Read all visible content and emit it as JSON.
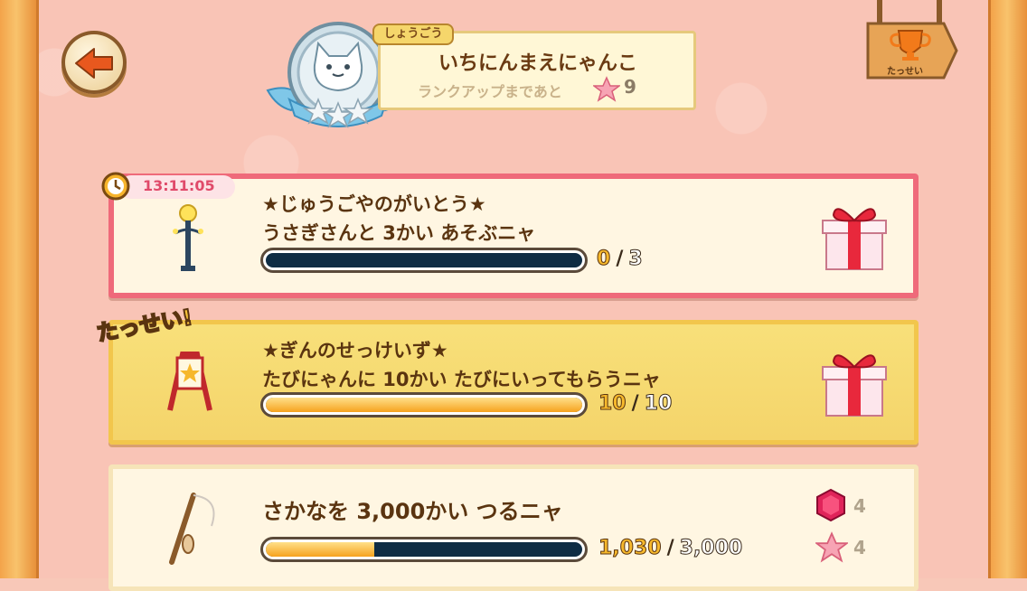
{
  "header": {
    "rank_tag": "しょうごう",
    "rank_title": "いちにんまえにゃんこ",
    "rank_up_text": "ランクアップまであと",
    "rank_up_count": "9",
    "achievements_label": "たっせい"
  },
  "missions": [
    {
      "timer": "13:11:05",
      "title_line1": "★じゅうごやのがいとう★",
      "title_line2": "うさぎさんと 3かい あそぶニャ",
      "current": "0",
      "total": "3",
      "progress_fraction": 0,
      "reward": "gift-box"
    },
    {
      "badge": "たっせい!",
      "title_line1": "★ぎんのせっけいず★",
      "title_line2": "たびにゃんに 10かい たびにいってもらうニャ",
      "current": "10",
      "total": "10",
      "progress_fraction": 1,
      "reward": "gift-box"
    },
    {
      "title_line1": "さかなを 3,000かい つるニャ",
      "current": "1,030",
      "total": "3,000",
      "progress_fraction": 0.343,
      "rewards": [
        {
          "icon": "gem-icon",
          "count": "4"
        },
        {
          "icon": "star-icon",
          "count": "4"
        }
      ]
    }
  ],
  "colors": {
    "background": "#f9c4b6",
    "card_active_border": "#ef6a7a",
    "card_done": "#f6dc72",
    "progress_fill": "#f6a21e",
    "progress_empty": "#0e2c44",
    "timer_text": "#e04a6a"
  }
}
